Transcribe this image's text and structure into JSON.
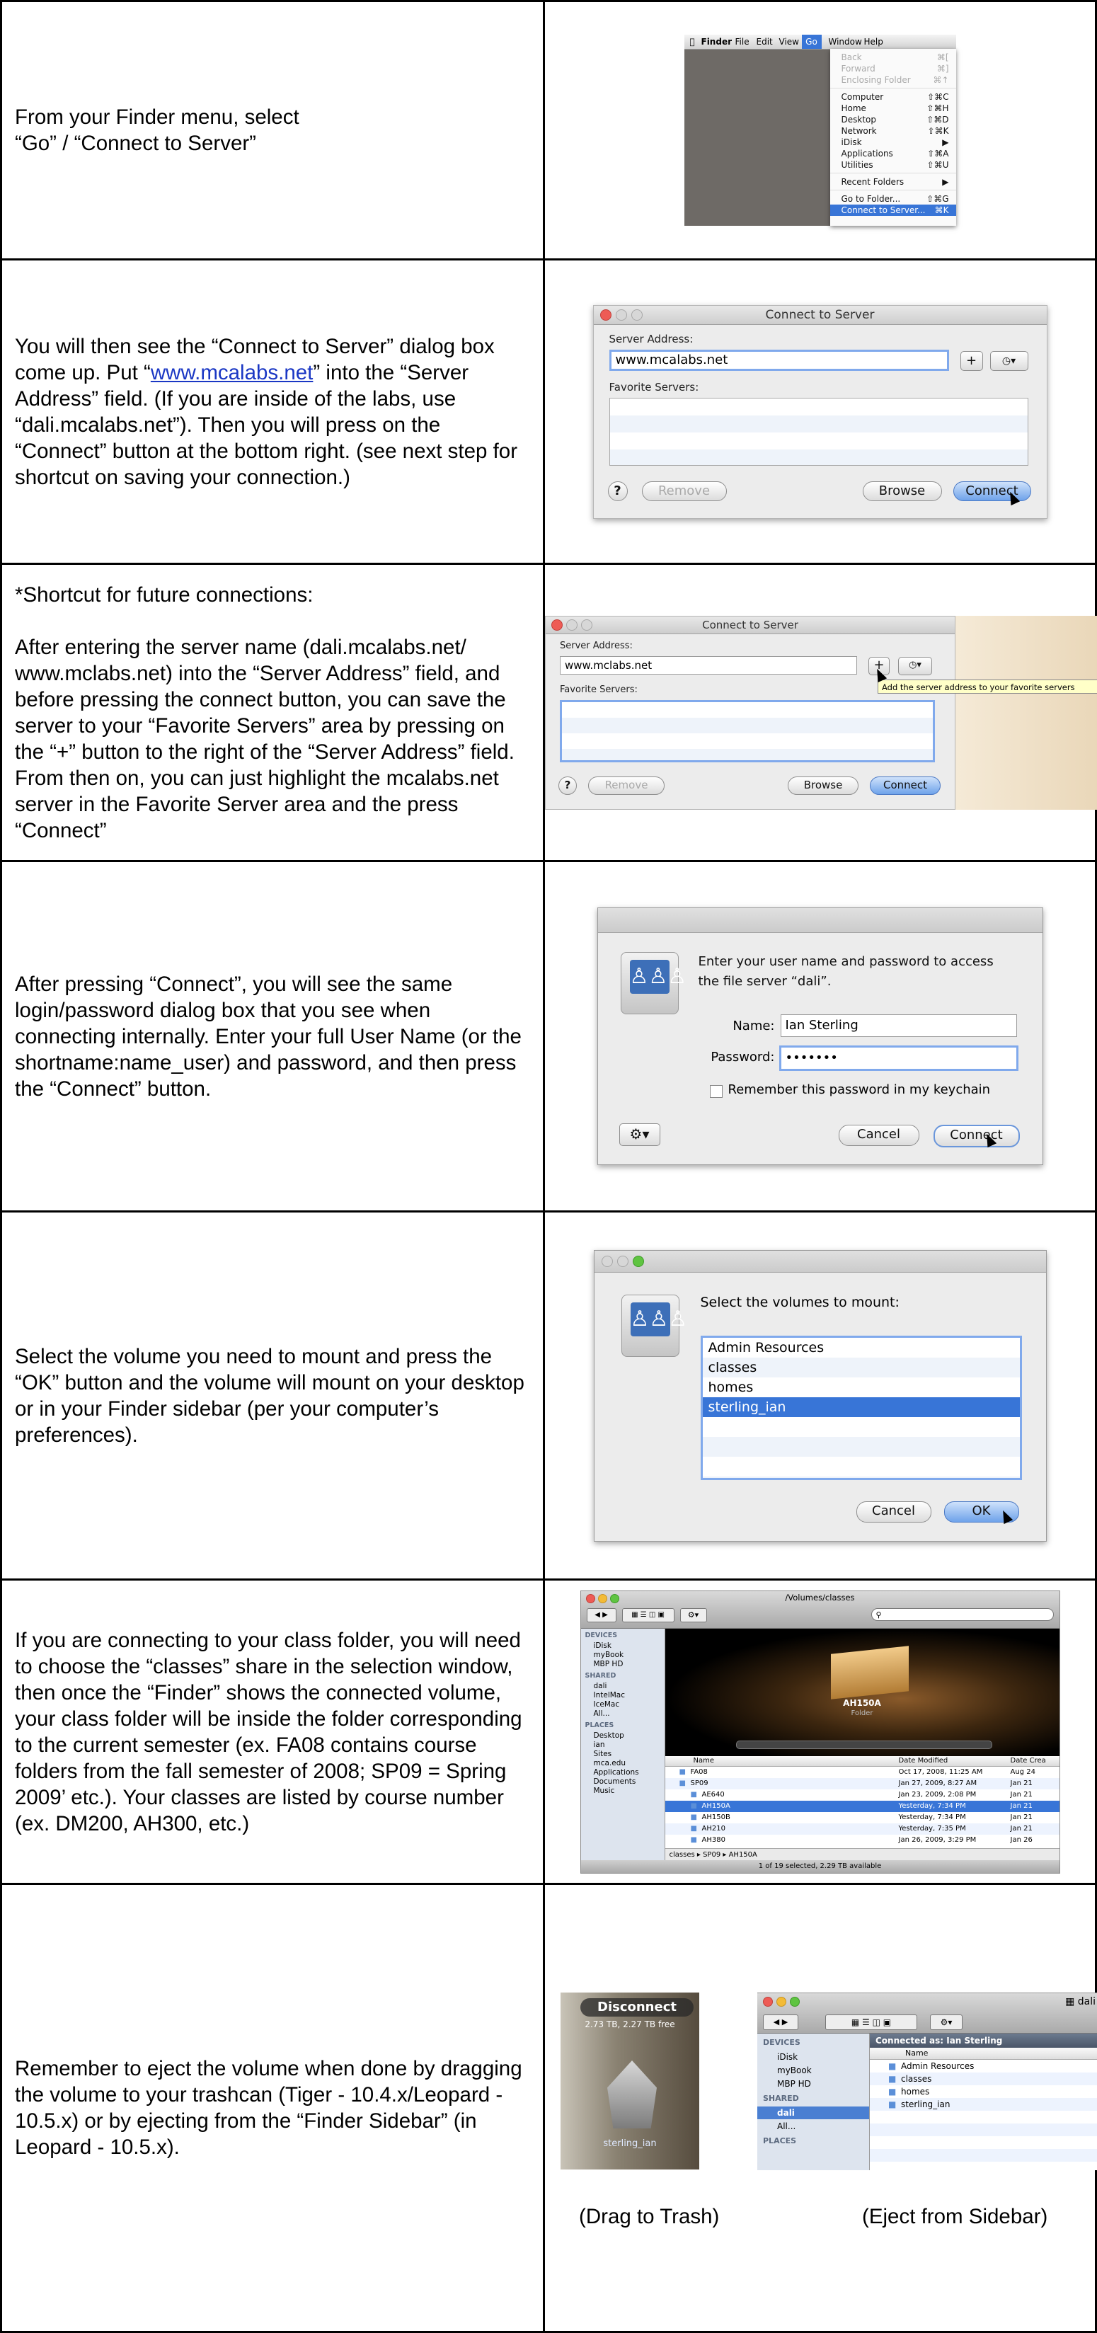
{
  "rows": [
    {
      "text": [
        "From your Finder menu, select",
        "“Go” / “Connect to Server”"
      ],
      "menu": {
        "bar": [
          "Finder",
          "File",
          "Edit",
          "View",
          "Go",
          "Window",
          "Help"
        ],
        "items": [
          {
            "label": "Back",
            "key": "⌘[",
            "disabled": true
          },
          {
            "label": "Forward",
            "key": "⌘]",
            "disabled": true
          },
          {
            "label": "Enclosing Folder",
            "key": "⌘↑",
            "disabled": true
          },
          {
            "label": "Computer",
            "key": "⇧⌘C"
          },
          {
            "label": "Home",
            "key": "⇧⌘H"
          },
          {
            "label": "Desktop",
            "key": "⇧⌘D"
          },
          {
            "label": "Network",
            "key": "⇧⌘K"
          },
          {
            "label": "iDisk",
            "key": "▶"
          },
          {
            "label": "Applications",
            "key": "⇧⌘A"
          },
          {
            "label": "Utilities",
            "key": "⇧⌘U"
          },
          {
            "label": "Recent Folders",
            "key": "▶"
          },
          {
            "label": "Go to Folder...",
            "key": "⇧⌘G"
          },
          {
            "label": "Connect to Server...",
            "key": "⌘K",
            "selected": true
          }
        ]
      }
    },
    {
      "text_before_link": "You will then see the “Connect to Server” dialog box come up.  Put “",
      "link": "www.mcalabs.net",
      "text_after_link": "” into the “Server Address” field.  (If you are inside of the labs, use “dali.mcalabs.net”).  Then you will press on the “Connect” button at the bottom right. (see next step for shortcut on saving your connection.)",
      "dialog": {
        "title": "Connect to Server",
        "server_address_label": "Server Address:",
        "server_value": "www.mcalabs.net",
        "plus": "+",
        "favorites_label": "Favorite Servers:",
        "help": "?",
        "remove": "Remove",
        "browse": "Browse",
        "connect": "Connect"
      }
    },
    {
      "text_1": "*Shortcut for future connections:",
      "text_2": "After entering the server name (dali.mcalabs.net/ www.mclabs.net) into the “Server Address” field, and before pressing the connect button, you can save the server to your “Favorite Servers” area by pressing on the “+” button to the right of the “Server Address” field.  From then on, you can just highlight the mcalabs.net server in the Favorite Server area and the press “Connect”",
      "dialog": {
        "title": "Connect to Server",
        "server_address_label": "Server Address:",
        "server_value": "www.mclabs.net",
        "plus": "+",
        "tooltip": "Add the server address to your favorite servers",
        "favorites_label": "Favorite Servers:",
        "help": "?",
        "remove": "Remove",
        "browse": "Browse",
        "connect": "Connect"
      }
    },
    {
      "text": "After pressing “Connect”, you will see the same login/password dialog box that you see when connecting internally.  Enter your full User Name (or the shortname:name_user) and password, and then press the “Connect” button.",
      "dialog": {
        "message_1": "Enter your user name and password to access",
        "message_2": "the file server “dali”.",
        "name_label": "Name:",
        "name_value": "Ian Sterling",
        "password_label": "Password:",
        "password_value": "•••••••",
        "remember": "Remember this password in my keychain",
        "cancel": "Cancel",
        "connect": "Connect"
      }
    },
    {
      "text": "Select the volume you need to mount and press the “OK” button and the volume will mount on your desktop or in your Finder sidebar (per your computer’s preferences).",
      "dialog": {
        "message": "Select the volumes to mount:",
        "volumes": [
          "Admin Resources",
          "classes",
          "homes",
          "sterling_ian"
        ],
        "selected_index": 3,
        "cancel": "Cancel",
        "ok": "OK"
      }
    },
    {
      "text": "If you are connecting to your class folder, you will need to choose the “classes” share in the selection window, then once the “Finder” shows the connected volume, your class folder will be inside the folder corresponding to the current semester (ex. FA08 contains course folders from the fall semester of 2008; SP09 = Spring 2009’ etc.).  Your classes are listed by course number (ex. DM200, AH300, etc.)",
      "finder": {
        "title": "/Volumes/classes",
        "sidebar": {
          "devices_header": "DEVICES",
          "devices": [
            "iDisk",
            "myBook",
            "MBP HD"
          ],
          "shared_header": "SHARED",
          "shared": [
            "dali",
            "IntelMac",
            "IceMac",
            "All..."
          ],
          "places_header": "PLACES",
          "places": [
            "Desktop",
            "ian",
            "Sites",
            "mca.edu",
            "Applications",
            "Documents",
            "Music"
          ]
        },
        "preview_name": "AH150A",
        "preview_kind": "Folder",
        "columns": [
          "Name",
          "Date Modified",
          "Date Crea"
        ],
        "rows": [
          {
            "name": "FA08",
            "date": "Oct 17, 2008, 11:25 AM",
            "created": "Aug 24"
          },
          {
            "name": "SP09",
            "date": "Jan 27, 2009, 8:27 AM",
            "created": "Jan 21"
          },
          {
            "name": "AE640",
            "date": "Jan 23, 2009, 2:08 PM",
            "created": "Jan 21"
          },
          {
            "name": "AH150A",
            "date": "Yesterday, 7:34 PM",
            "created": "Jan 21",
            "selected": true
          },
          {
            "name": "AH150B",
            "date": "Yesterday, 7:34 PM",
            "created": "Jan 21"
          },
          {
            "name": "AH210",
            "date": "Yesterday, 7:35 PM",
            "created": "Jan 21"
          },
          {
            "name": "AH380",
            "date": "Jan 26, 2009, 3:29 PM",
            "created": "Jan 26"
          }
        ],
        "path": [
          "classes",
          "SP09",
          "AH150A"
        ],
        "status": "1 of 19 selected, 2.29 TB available"
      }
    },
    {
      "text": "Remember to eject the volume when done by dragging the volume to your trashcan (Tiger - 10.4.x/Leopard - 10.5.x) or by ejecting from the “Finder Sidebar” (in Leopard - 10.5.x).",
      "trash": {
        "label": "Disconnect",
        "size_line": "2.73 TB, 2.27 TB free",
        "volume_name": "sterling_ian"
      },
      "finder2": {
        "title": "dali",
        "connected_as": "Connected as: Ian Sterling",
        "name_col": "Name",
        "devices_header": "DEVICES",
        "devices": [
          "iDisk",
          "myBook",
          "MBP HD"
        ],
        "shared_header": "SHARED",
        "shared": [
          "dali",
          "All..."
        ],
        "places_header": "PLACES",
        "items": [
          "Admin Resources",
          "classes",
          "homes",
          "sterling_ian"
        ]
      },
      "caption_left": "(Drag to Trash)",
      "caption_right": "(Eject from Sidebar)"
    }
  ]
}
